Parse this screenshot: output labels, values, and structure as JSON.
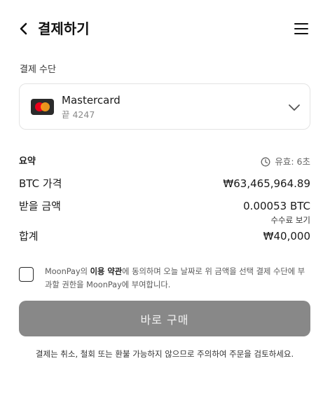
{
  "header": {
    "title": "결제하기",
    "back_icon": "chevron-left-icon",
    "menu_icon": "hamburger-menu-icon"
  },
  "payment_method": {
    "section_label": "결제 수단",
    "brand": "Mastercard",
    "last4_label": "끝 4247",
    "logo_icon": "mastercard-logo-icon",
    "dropdown_icon": "chevron-down-icon"
  },
  "summary": {
    "label": "요약",
    "timer_icon": "clock-icon",
    "timer_text": "유효: 6초",
    "btc_price_label": "BTC 가격",
    "btc_price_value": "₩63,465,964.89",
    "receive_label": "받을 금액",
    "receive_value": "0.00053 BTC",
    "fee_link": "수수료 보기",
    "total_label": "합계",
    "total_value": "₩40,000"
  },
  "consent": {
    "part1": "MoonPay의 ",
    "terms_link": "이용 약관",
    "part2": "에 동의하며 오늘 날짜로 위 금액을 선택 결제 수단에 부과할 권한을 MoonPay에 부여합니다."
  },
  "buy_button": {
    "label": "바로 구매"
  },
  "notice": "결제는 취소, 철회 또는 환불 가능하지 않으므로 주의하여 주문을 검토하세요.",
  "colors": {
    "button_bg": "#888888",
    "mastercard_red": "#eb001b",
    "mastercard_orange": "#f79e1b"
  }
}
